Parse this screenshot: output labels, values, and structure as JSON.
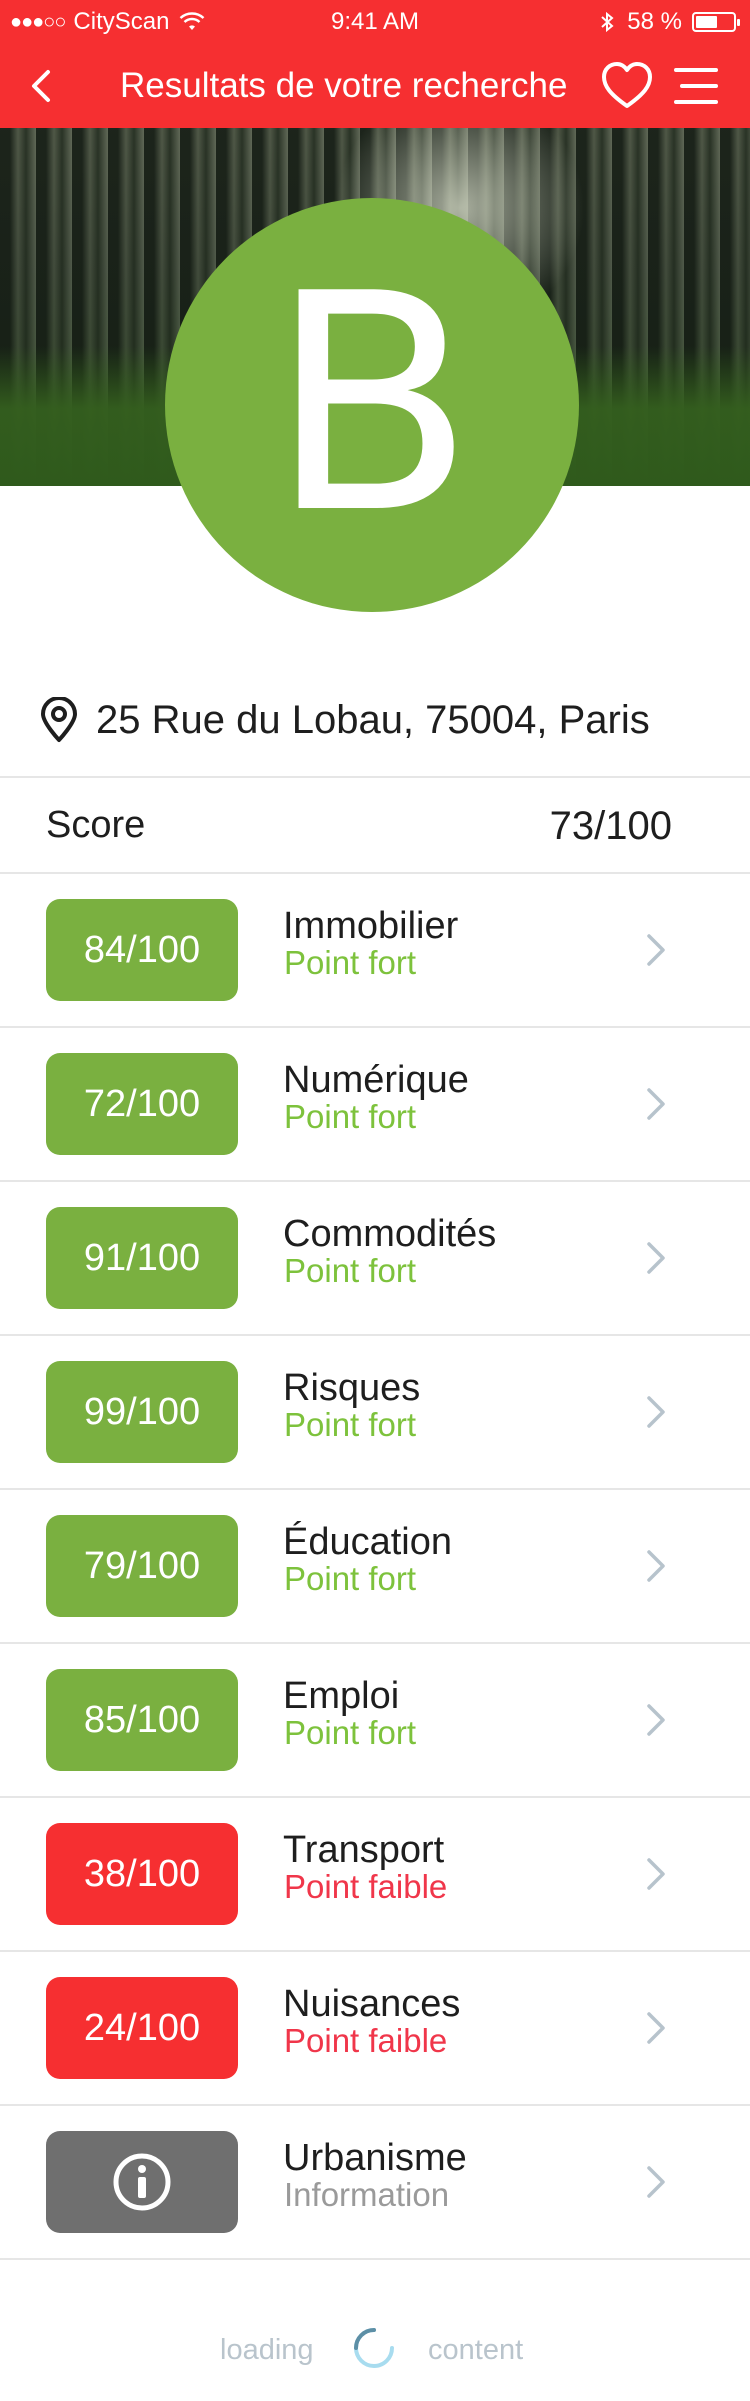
{
  "status_bar": {
    "carrier": "CityScan",
    "time": "9:41 AM",
    "battery": "58 %",
    "battery_level": 0.58
  },
  "nav": {
    "title": "Resultats de votre recherche",
    "back_icon": "chevron-left-icon",
    "favorite_icon": "heart-icon",
    "menu_icon": "hamburger-menu-icon"
  },
  "grade": {
    "letter": "B",
    "color": "#7ab040"
  },
  "address": {
    "icon": "map-pin-icon",
    "text": "25 Rue du Lobau, 75004, Paris"
  },
  "score": {
    "label": "Score",
    "value": "73/100"
  },
  "colors": {
    "brand": "#f62f31",
    "strong": "#7ab040",
    "strong_text": "#7dc23c",
    "weak": "#f62f31",
    "weak_text": "#f0364a",
    "info": "#6f6f6f",
    "info_text": "#9a9a9a"
  },
  "categories": [
    {
      "score": "84/100",
      "name": "Immobilier",
      "status": "Point fort",
      "kind": "strong"
    },
    {
      "score": "72/100",
      "name": "Numérique",
      "status": "Point fort",
      "kind": "strong"
    },
    {
      "score": "91/100",
      "name": "Commodités",
      "status": "Point fort",
      "kind": "strong"
    },
    {
      "score": "99/100",
      "name": "Risques",
      "status": "Point fort",
      "kind": "strong"
    },
    {
      "score": "79/100",
      "name": "Éducation",
      "status": "Point fort",
      "kind": "strong"
    },
    {
      "score": "85/100",
      "name": "Emploi",
      "status": "Point fort",
      "kind": "strong"
    },
    {
      "score": "38/100",
      "name": "Transport",
      "status": "Point faible",
      "kind": "weak"
    },
    {
      "score": "24/100",
      "name": "Nuisances",
      "status": "Point faible",
      "kind": "weak"
    },
    {
      "score": "",
      "name": "Urbanisme",
      "status": "Information",
      "kind": "info",
      "icon": "info-circle-icon"
    }
  ],
  "loading": {
    "left": "loading",
    "right": "content"
  }
}
